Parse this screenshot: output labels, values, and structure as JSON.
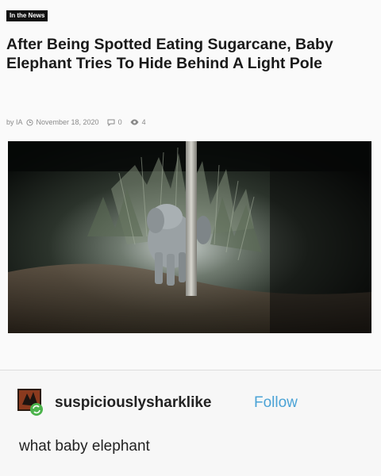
{
  "article": {
    "badge": "In the News",
    "headline": "After Being Spotted Eating Sugarcane, Baby Elephant Tries To Hide Behind A Light Pole",
    "meta": {
      "author": "by IA",
      "date": "November 18, 2020",
      "comments": "0",
      "views": "4",
      "icons": [
        "clock-icon",
        "comment-icon",
        "eye-icon"
      ]
    }
  },
  "post": {
    "username": "suspiciouslysharklike",
    "follow_label": "Follow",
    "text": "what baby elephant"
  },
  "colors": {
    "follow": "#4ba3d6",
    "badge_bg": "#111111",
    "meta_text": "#8a8a8a"
  }
}
